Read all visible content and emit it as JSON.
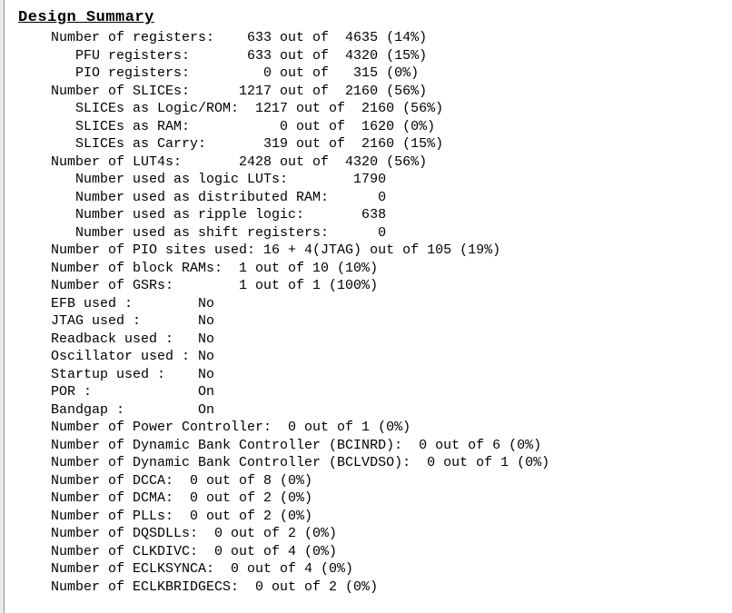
{
  "document": {
    "title": "Design Summary",
    "type": "fpga-synthesis-report",
    "font": "monospace"
  },
  "colors": {
    "background": "#ffffff",
    "text": "#000000",
    "gutter_band": "#ebebeb",
    "gutter_rule": "#8a9099"
  },
  "report": {
    "lines": [
      "    Number of registers:    633 out of  4635 (14%)",
      "       PFU registers:       633 out of  4320 (15%)",
      "       PIO registers:         0 out of   315 (0%)",
      "    Number of SLICEs:      1217 out of  2160 (56%)",
      "       SLICEs as Logic/ROM:  1217 out of  2160 (56%)",
      "       SLICEs as RAM:           0 out of  1620 (0%)",
      "       SLICEs as Carry:       319 out of  2160 (15%)",
      "    Number of LUT4s:       2428 out of  4320 (56%)",
      "       Number used as logic LUTs:        1790",
      "       Number used as distributed RAM:      0",
      "       Number used as ripple logic:       638",
      "       Number used as shift registers:      0",
      "    Number of PIO sites used: 16 + 4(JTAG) out of 105 (19%)",
      "    Number of block RAMs:  1 out of 10 (10%)",
      "    Number of GSRs:        1 out of 1 (100%)",
      "    EFB used :        No",
      "    JTAG used :       No",
      "    Readback used :   No",
      "    Oscillator used : No",
      "    Startup used :    No",
      "    POR :             On",
      "    Bandgap :         On",
      "    Number of Power Controller:  0 out of 1 (0%)",
      "    Number of Dynamic Bank Controller (BCINRD):  0 out of 6 (0%)",
      "    Number of Dynamic Bank Controller (BCLVDSO):  0 out of 1 (0%)",
      "    Number of DCCA:  0 out of 8 (0%)",
      "    Number of DCMA:  0 out of 2 (0%)",
      "    Number of PLLs:  0 out of 2 (0%)",
      "    Number of DQSDLLs:  0 out of 2 (0%)",
      "    Number of CLKDIVC:  0 out of 4 (0%)",
      "    Number of ECLKSYNCA:  0 out of 4 (0%)",
      "    Number of ECLKBRIDGECS:  0 out of 2 (0%)"
    ],
    "resources": [
      {
        "name": "Number of registers",
        "used": "633",
        "available": "4635",
        "percent": "14%"
      },
      {
        "name": "PFU registers",
        "used": "633",
        "available": "4320",
        "percent": "15%"
      },
      {
        "name": "PIO registers",
        "used": "0",
        "available": "315",
        "percent": "0%"
      },
      {
        "name": "Number of SLICEs",
        "used": "1217",
        "available": "2160",
        "percent": "56%"
      },
      {
        "name": "SLICEs as Logic/ROM",
        "used": "1217",
        "available": "2160",
        "percent": "56%"
      },
      {
        "name": "SLICEs as RAM",
        "used": "0",
        "available": "1620",
        "percent": "0%"
      },
      {
        "name": "SLICEs as Carry",
        "used": "319",
        "available": "2160",
        "percent": "15%"
      },
      {
        "name": "Number of LUT4s",
        "used": "2428",
        "available": "4320",
        "percent": "56%"
      },
      {
        "name": "Number used as logic LUTs",
        "used": "1790",
        "available": "",
        "percent": ""
      },
      {
        "name": "Number used as distributed RAM",
        "used": "0",
        "available": "",
        "percent": ""
      },
      {
        "name": "Number used as ripple logic",
        "used": "638",
        "available": "",
        "percent": ""
      },
      {
        "name": "Number used as shift registers",
        "used": "0",
        "available": "",
        "percent": ""
      },
      {
        "name": "Number of PIO sites used",
        "used": "16 + 4(JTAG)",
        "available": "105",
        "percent": "19%"
      },
      {
        "name": "Number of block RAMs",
        "used": "1",
        "available": "10",
        "percent": "10%"
      },
      {
        "name": "Number of GSRs",
        "used": "1",
        "available": "1",
        "percent": "100%"
      },
      {
        "name": "Number of Power Controller",
        "used": "0",
        "available": "1",
        "percent": "0%"
      },
      {
        "name": "Number of Dynamic Bank Controller (BCINRD)",
        "used": "0",
        "available": "6",
        "percent": "0%"
      },
      {
        "name": "Number of Dynamic Bank Controller (BCLVDSO)",
        "used": "0",
        "available": "1",
        "percent": "0%"
      },
      {
        "name": "Number of DCCA",
        "used": "0",
        "available": "8",
        "percent": "0%"
      },
      {
        "name": "Number of DCMA",
        "used": "0",
        "available": "2",
        "percent": "0%"
      },
      {
        "name": "Number of PLLs",
        "used": "0",
        "available": "2",
        "percent": "0%"
      },
      {
        "name": "Number of DQSDLLs",
        "used": "0",
        "available": "2",
        "percent": "0%"
      },
      {
        "name": "Number of CLKDIVC",
        "used": "0",
        "available": "4",
        "percent": "0%"
      },
      {
        "name": "Number of ECLKSYNCA",
        "used": "0",
        "available": "4",
        "percent": "0%"
      },
      {
        "name": "Number of ECLKBRIDGECS",
        "used": "0",
        "available": "2",
        "percent": "0%"
      }
    ],
    "flags": [
      {
        "name": "EFB used",
        "value": "No"
      },
      {
        "name": "JTAG used",
        "value": "No"
      },
      {
        "name": "Readback used",
        "value": "No"
      },
      {
        "name": "Oscillator used",
        "value": "No"
      },
      {
        "name": "Startup used",
        "value": "No"
      },
      {
        "name": "POR",
        "value": "On"
      },
      {
        "name": "Bandgap",
        "value": "On"
      }
    ]
  }
}
